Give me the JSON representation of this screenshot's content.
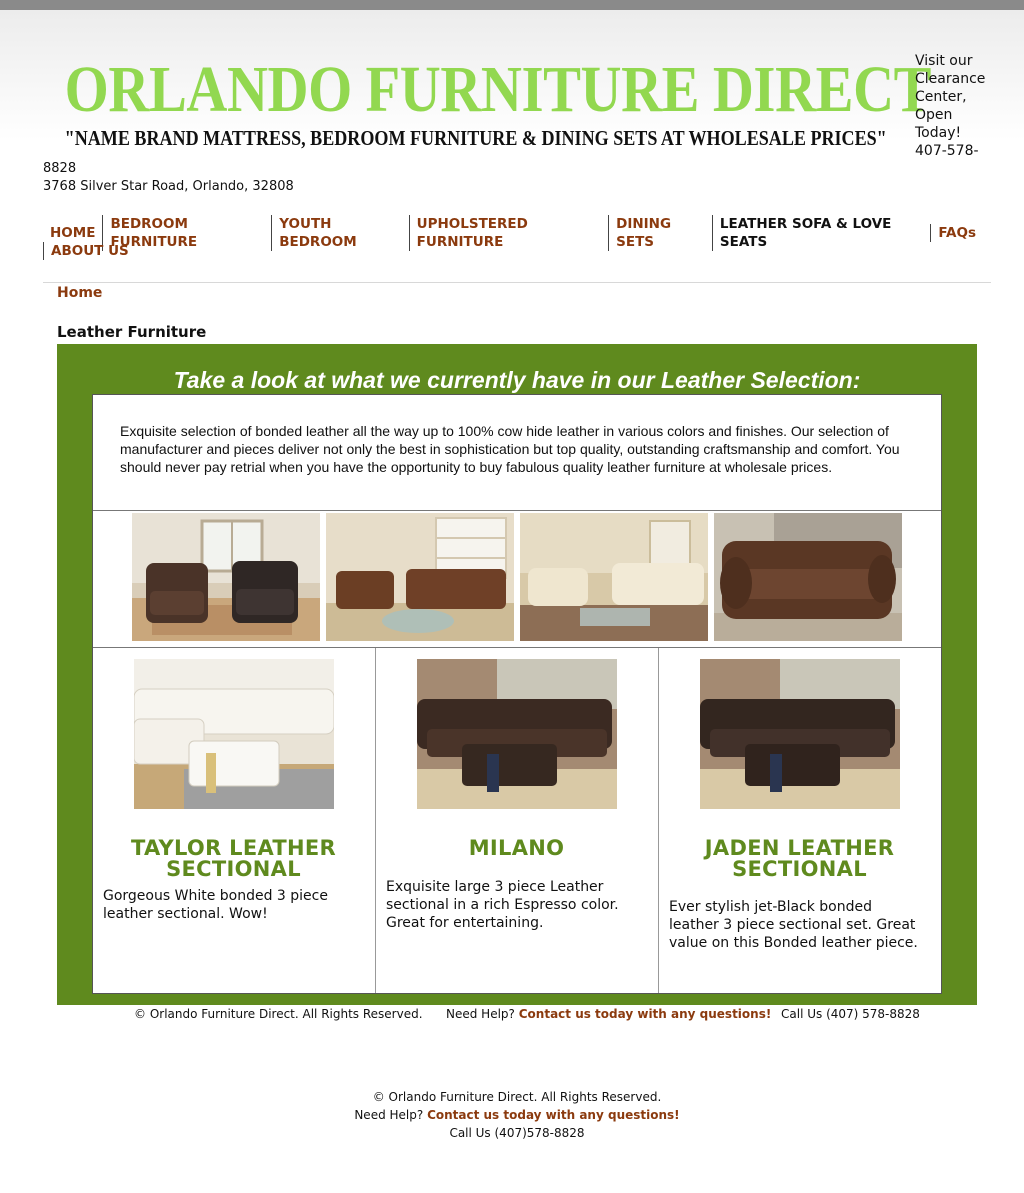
{
  "header": {
    "site_title": "ORLANDO FURNITURE DIRECT",
    "tagline": "\"NAME BRAND MATTRESS, BEDROOM FURNITURE & DINING SETS AT WHOLESALE PRICES\"",
    "clearance_lines": [
      "Visit our",
      "Clearance",
      "Center,",
      "Open",
      "Today!",
      "407-578-"
    ],
    "address_line1": "8828",
    "address_line2": "3768 Silver Star Road, Orlando, 32808"
  },
  "nav": {
    "row1": [
      "HOME",
      "BEDROOM FURNITURE",
      "YOUTH BEDROOM",
      "UPHOLSTERED FURNITURE",
      "DINING SETS",
      "LEATHER SOFA & LOVE SEATS",
      "FAQs"
    ],
    "row2": [
      "ABOUT US"
    ],
    "active": "LEATHER SOFA & LOVE SEATS"
  },
  "breadcrumb": "Home",
  "page_heading": "Leather Furniture",
  "promo_heading": "Take a look at what we currently have in our Leather Selection:",
  "intro_text": "Exquisite selection of bonded leather all the way up to 100% cow hide leather in various colors and finishes. Our selection of manufacturer and pieces deliver not only the best in sophistication but top quality, outstanding craftsmanship and comfort. You should never pay retrial when you have the opportunity to buy fabulous quality leather furniture at wholesale prices.",
  "gallery": [
    {
      "icon": "leather-armchairs-photo"
    },
    {
      "icon": "brown-sofa-set-photo"
    },
    {
      "icon": "cream-sofa-set-photo"
    },
    {
      "icon": "brown-sofa-photo"
    }
  ],
  "products": [
    {
      "title_line1": "TAYLOR LEATHER",
      "title_line2": "SECTIONAL",
      "description": "Gorgeous White bonded 3 piece leather sectional. Wow!",
      "icon": "white-sectional-photo"
    },
    {
      "title_line1": "MILANO",
      "title_line2": "",
      "description": "Exquisite large 3 piece Leather sectional in a rich Espresso color. Great for entertaining.",
      "icon": "espresso-sectional-photo"
    },
    {
      "title_line1": "JADEN LEATHER",
      "title_line2": "SECTIONAL",
      "description": "Ever stylish jet-Black bonded leather 3 piece sectional set. Great value on this Bonded leather piece.",
      "icon": "black-sectional-photo"
    }
  ],
  "footer_inner": {
    "copyright": "© Orlando Furniture Direct. All Rights Reserved.",
    "help_prefix": "Need Help?",
    "help_link": "Contact us today with any questions!",
    "phone": "Call Us (407) 578-8828"
  },
  "footer_outer": {
    "copyright": "© Orlando Furniture Direct. All Rights Reserved.",
    "help_prefix": "Need Help?",
    "help_link": "Contact us today with any questions!",
    "phone": "Call Us (407)578-8828"
  },
  "colors": {
    "title_green": "#92d850",
    "panel_green": "#5f8a1e",
    "link_brown": "#8b3a0e"
  }
}
